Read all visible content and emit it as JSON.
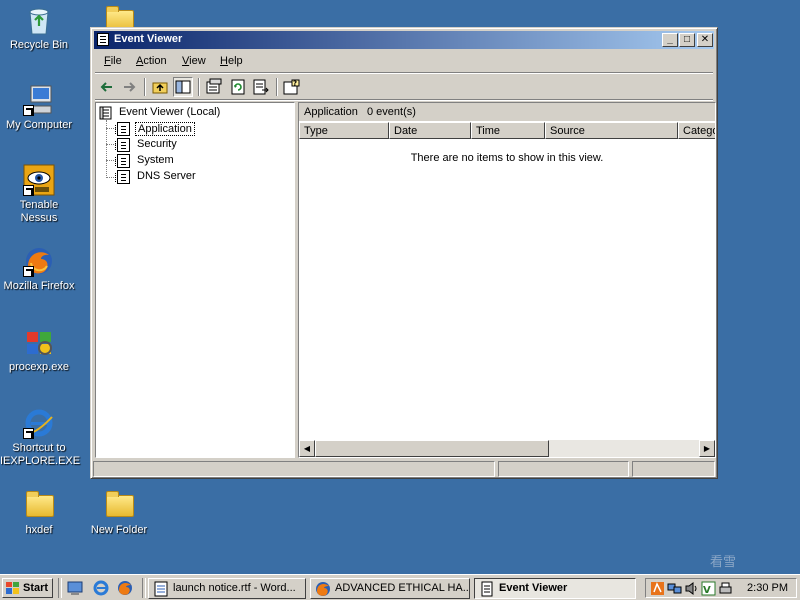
{
  "desktop": {
    "icons": [
      {
        "label": "Recycle Bin"
      },
      {
        "label": "My Computer"
      },
      {
        "label": "Tenable Nessus"
      },
      {
        "label": "Mozilla Firefox"
      },
      {
        "label": "procexp.exe"
      },
      {
        "label": "Shortcut to IEXPLORE.EXE"
      },
      {
        "label": "hxdef"
      },
      {
        "label": "New Folder"
      }
    ],
    "watermark": "看雪"
  },
  "window": {
    "title": "Event Viewer",
    "controls": {
      "minimize": "_",
      "maximize": "□",
      "close": "✕"
    },
    "menu": [
      {
        "label": "File",
        "accel": "F",
        "rest": "ile"
      },
      {
        "label": "Action",
        "accel": "A",
        "rest": "ction"
      },
      {
        "label": "View",
        "accel": "V",
        "rest": "iew"
      },
      {
        "label": "Help",
        "accel": "H",
        "rest": "elp"
      }
    ],
    "toolbar": [
      "back-icon",
      "forward-icon",
      "up-folder-icon",
      "show-hide-tree-icon",
      "properties-icon",
      "refresh-icon",
      "export-list-icon",
      "help-icon"
    ],
    "tree": {
      "root": "Event Viewer (Local)",
      "items": [
        {
          "label": "Application",
          "selected": true
        },
        {
          "label": "Security"
        },
        {
          "label": "System"
        },
        {
          "label": "DNS Server"
        }
      ]
    },
    "list": {
      "header_name": "Application",
      "header_count": "0 event(s)",
      "columns": [
        "Type",
        "Date",
        "Time",
        "Source",
        "Category"
      ],
      "empty_message": "There are no items to show in this view."
    }
  },
  "taskbar": {
    "start_label": "Start",
    "quick_launch": [
      "show-desktop-icon",
      "ie-quicklaunch-icon",
      "firefox-quicklaunch-icon"
    ],
    "buttons": [
      {
        "label": "launch notice.rtf - Word...",
        "active": false
      },
      {
        "label": "ADVANCED ETHICAL HA...",
        "active": false
      },
      {
        "label": "Event Viewer",
        "active": true
      }
    ],
    "clock": "2:30 PM"
  }
}
